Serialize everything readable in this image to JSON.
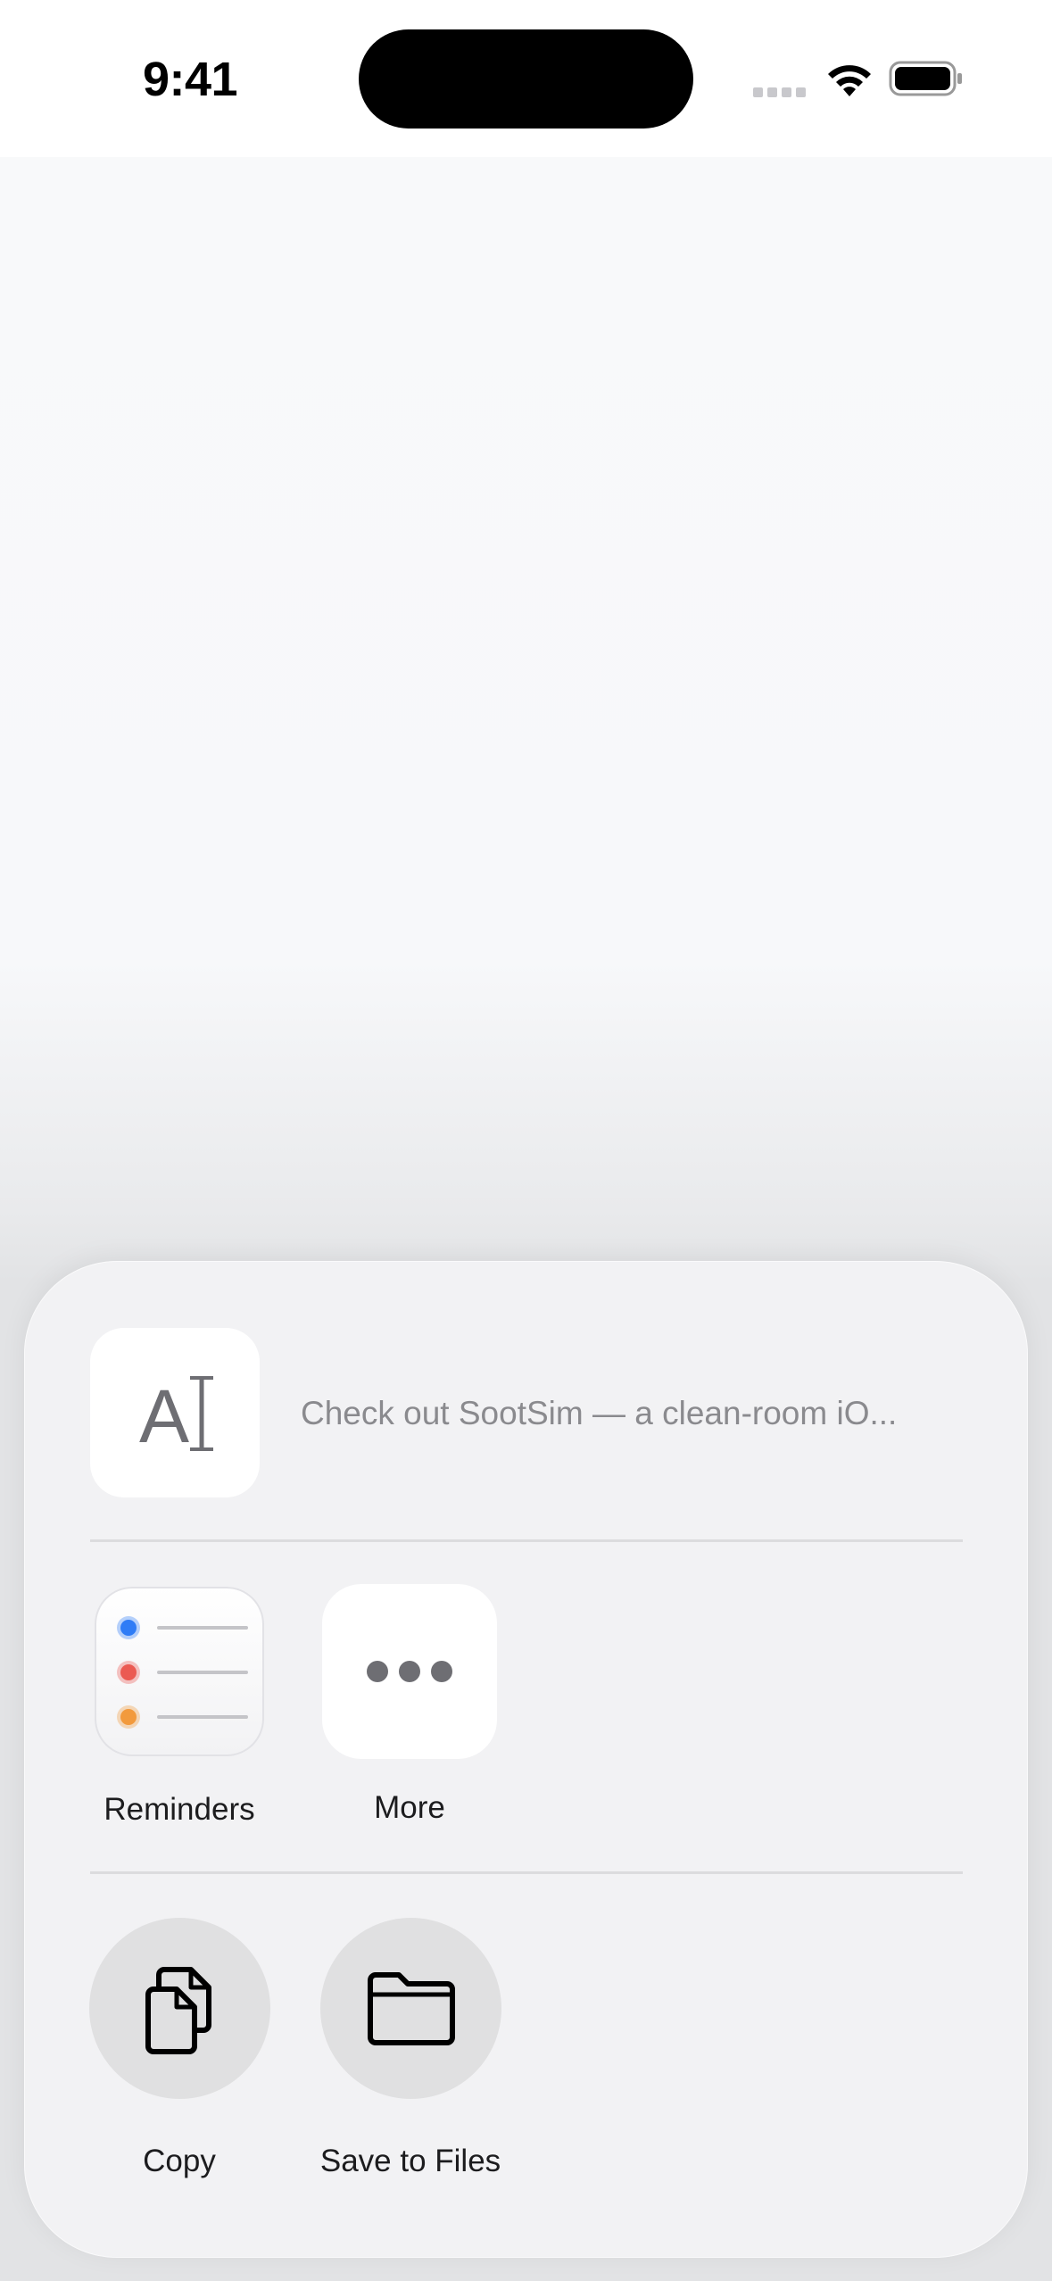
{
  "status_bar": {
    "time": "9:41"
  },
  "share_sheet": {
    "preview": {
      "icon": "text-cursor-icon",
      "icon_text": "A",
      "text": "Check out SootSim — a clean-room iO..."
    },
    "apps": [
      {
        "label": "Reminders",
        "icon": "reminders-icon",
        "dot_colors": [
          "#2f7cf6",
          "#eb5a52",
          "#f29a3d"
        ]
      },
      {
        "label": "More",
        "icon": "more-dots-icon"
      }
    ],
    "actions": [
      {
        "label": "Copy",
        "icon": "copy-icon"
      },
      {
        "label": "Save to Files",
        "icon": "folder-icon"
      }
    ]
  }
}
